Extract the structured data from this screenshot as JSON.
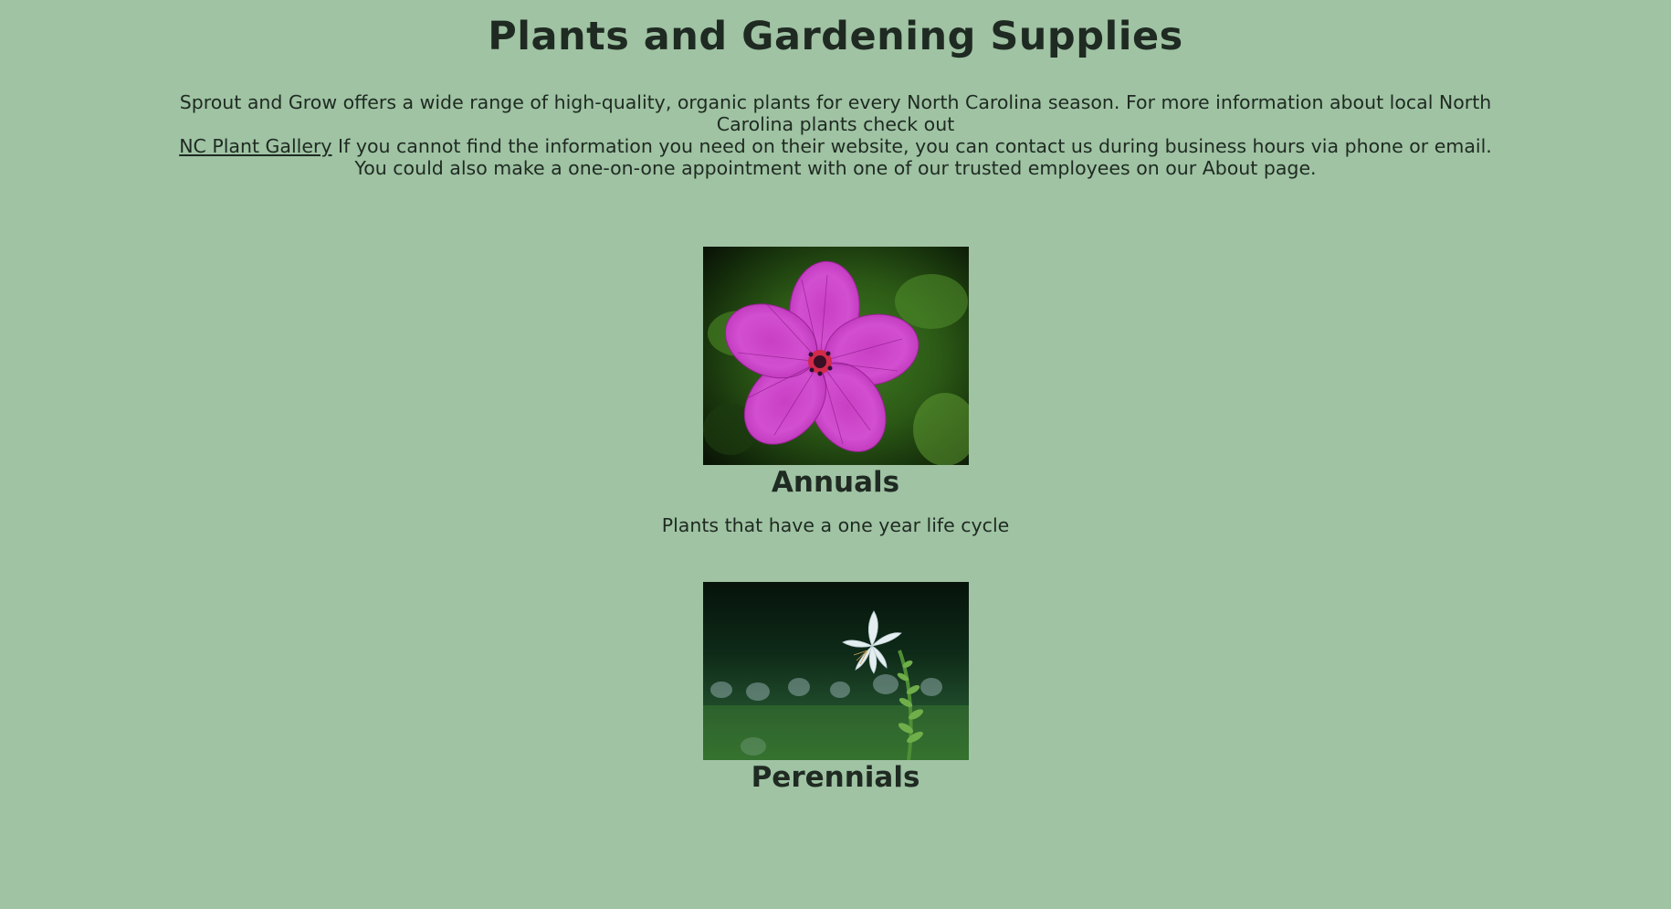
{
  "header": {
    "title": "Plants and Gardening Supplies"
  },
  "intro": {
    "text_before_link": "Sprout and Grow offers a wide range of high-quality, organic plants for every North Carolina season. For more information about local North Carolina plants check out",
    "link_label": "NC Plant Gallery",
    "text_after_link": " If you cannot find the information you need on their website, you can contact us during business hours via phone or email. You could also make a one-on-one appointment with one of our trusted employees on our About page."
  },
  "sections": [
    {
      "title": "Annuals",
      "description": "Plants that have a one year life cycle",
      "image_icon": "pink-geranium-flower-photo"
    },
    {
      "title": "Perennials",
      "image_icon": "white-hosta-lily-photo"
    }
  ],
  "colors": {
    "background": "#9fc3a3",
    "text": "#1f2a22"
  }
}
